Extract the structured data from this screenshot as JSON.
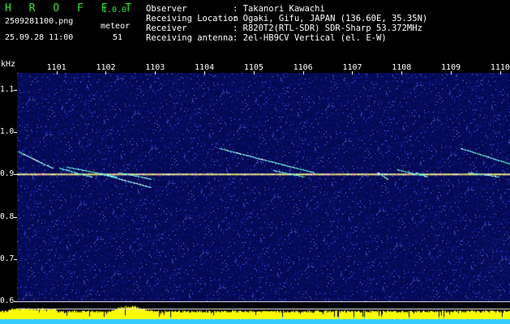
{
  "header": {
    "app_title": "H R O F F T",
    "version": "1.0.0",
    "file_name": "2509281100.png",
    "datetime": "25.09.28 11:00",
    "meteor_label": "meteor",
    "meteor_count": "51"
  },
  "info": [
    {
      "label": "Observer",
      "value": ": Takanori Kawachi"
    },
    {
      "label": "Receiving Location",
      "value": ": Ogaki, Gifu, JAPAN (136.60E, 35.35N)"
    },
    {
      "label": "Receiver",
      "value": ": R820T2(RTL-SDR) SDR-Sharp 53.372MHz"
    },
    {
      "label": "Receiving antenna",
      "value": ": 2el-HB9CV Vertical (el. E-W)"
    }
  ],
  "chart_data": {
    "type": "heatmap",
    "y_unit": "kHz",
    "y_ticks": [
      "1.1",
      "1.0",
      "0.9",
      "0.8",
      "0.7",
      "0.6"
    ],
    "ylim": [
      0.6,
      1.14
    ],
    "x_ticks": [
      "1101",
      "1102",
      "1103",
      "1104",
      "1105",
      "1106",
      "1107",
      "1108",
      "1109",
      "1110"
    ],
    "xlim": [
      1100.2,
      1110.2
    ],
    "carrier_khz": 0.9,
    "meteor_traces": [
      {
        "x": [
          1100.22,
          1100.9
        ],
        "y": [
          0.955,
          0.915
        ]
      },
      {
        "x": [
          1101.05,
          1101.7
        ],
        "y": [
          0.915,
          0.895
        ]
      },
      {
        "x": [
          1101.2,
          1102.2
        ],
        "y": [
          0.918,
          0.895
        ]
      },
      {
        "x": [
          1101.95,
          1102.9
        ],
        "y": [
          0.9,
          0.87
        ]
      },
      {
        "x": [
          1102.25,
          1102.9
        ],
        "y": [
          0.905,
          0.89
        ]
      },
      {
        "x": [
          1104.3,
          1106.2
        ],
        "y": [
          0.962,
          0.905
        ]
      },
      {
        "x": [
          1105.4,
          1106.0
        ],
        "y": [
          0.91,
          0.895
        ]
      },
      {
        "x": [
          1107.5,
          1107.7
        ],
        "y": [
          0.905,
          0.89
        ]
      },
      {
        "x": [
          1107.9,
          1108.4
        ],
        "y": [
          0.912,
          0.898
        ]
      },
      {
        "x": [
          1108.3,
          1108.5
        ],
        "y": [
          0.905,
          0.895
        ]
      },
      {
        "x": [
          1109.2,
          1110.2
        ],
        "y": [
          0.962,
          0.925
        ]
      },
      {
        "x": [
          1109.35,
          1109.95
        ],
        "y": [
          0.905,
          0.895
        ]
      }
    ]
  },
  "colors": {
    "background": "#000000",
    "noise": "#1c2a9a",
    "carrier": "#ffff80",
    "trace": "#59e8e8",
    "title": "#2ee62e",
    "level_yellow": "#ffff00",
    "level_cyan": "#33ccff"
  }
}
